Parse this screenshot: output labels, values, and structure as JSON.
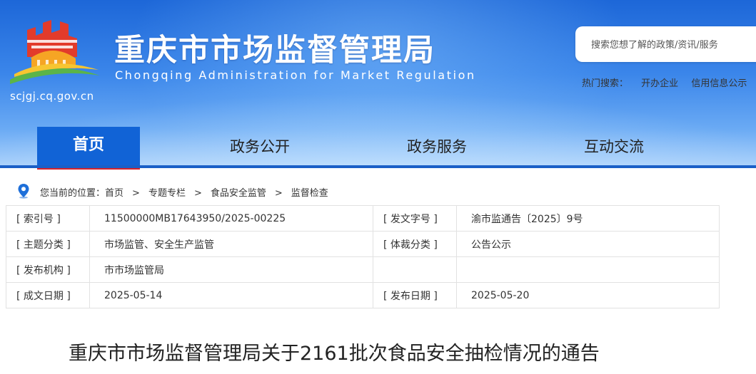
{
  "header": {
    "title_cn": "重庆市市场监督管理局",
    "title_en": "Chongqing  Administration for Market Regulation",
    "domain": "scjgj.cq.gov.cn",
    "search_placeholder": "搜索您想了解的政策/资讯/服务",
    "hot_search_label": "热门搜索：",
    "hot_search_items": [
      "开办企业",
      "信用信息公示"
    ]
  },
  "nav": {
    "items": [
      "首页",
      "政务公开",
      "政务服务",
      "互动交流"
    ],
    "active_index": 0
  },
  "breadcrumb": {
    "prefix": "您当前的位置：",
    "items": [
      "首页",
      "专题专栏",
      "食品安全监管",
      "监督检查"
    ],
    "separator": ">"
  },
  "meta": {
    "rows": [
      [
        "[ 索引号 ]",
        "11500000MB17643950/2025-00225",
        "[ 发文字号 ]",
        "渝市监通告〔2025〕9号"
      ],
      [
        "[ 主题分类 ]",
        "市场监管、安全生产监管",
        "[ 体裁分类 ]",
        "公告公示"
      ],
      [
        "[ 发布机构 ]",
        "市市场监管局",
        "",
        ""
      ],
      [
        "[ 成文日期 ]",
        "2025-05-14",
        "[ 发布日期 ]",
        "2025-05-20"
      ]
    ]
  },
  "article": {
    "title": "重庆市市场监督管理局关于2161批次食品安全抽检情况的通告"
  },
  "colors": {
    "header_blue": "#1d67d8",
    "nav_active": "#1163d6",
    "nav_active_underline": "#d8232a",
    "logo_red": "#e03a2a",
    "logo_orange": "#f5a623",
    "logo_green": "#5bb449"
  }
}
